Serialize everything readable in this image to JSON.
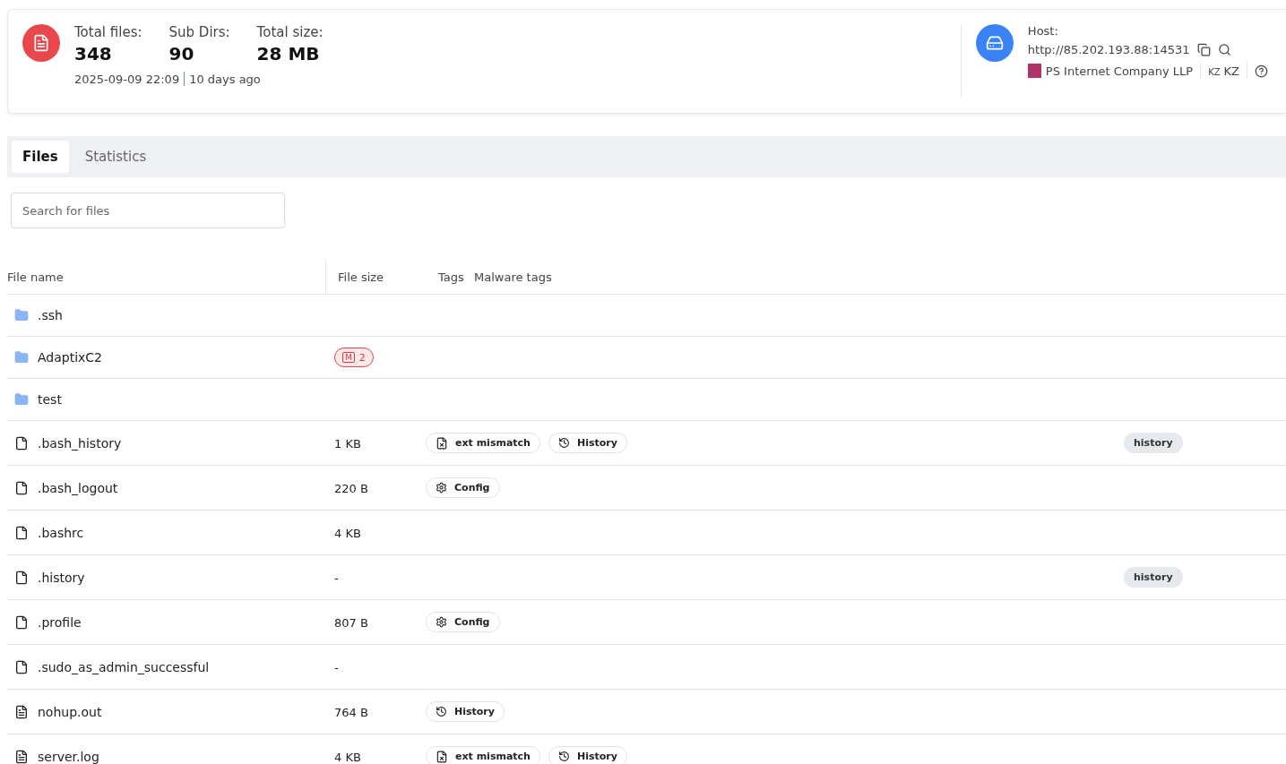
{
  "summary": {
    "stats": [
      {
        "label": "Total files:",
        "value": "348"
      },
      {
        "label": "Sub Dirs:",
        "value": "90"
      },
      {
        "label": "Total size:",
        "value": "28 MB"
      }
    ],
    "date": "2025-09-09 22:09",
    "ago": "10 days ago"
  },
  "host": {
    "label": "Host:",
    "url": "http://85.202.193.88:14531",
    "org": "PS Internet Company LLP",
    "country_code": "KZ",
    "country": "KZ"
  },
  "tabs": [
    {
      "label": "Files",
      "selected": true
    },
    {
      "label": "Statistics",
      "selected": false
    }
  ],
  "search": {
    "placeholder": "Search for files"
  },
  "table": {
    "columns": [
      "File name",
      "File size",
      "Tags",
      "Malware tags"
    ],
    "rows": [
      {
        "kind": "folder",
        "name": ".ssh"
      },
      {
        "kind": "folder",
        "name": "AdaptixC2",
        "badge": {
          "mark": "M",
          "count": "2"
        }
      },
      {
        "kind": "folder",
        "name": "test"
      },
      {
        "kind": "file",
        "name": ".bash_history",
        "size": "1 KB",
        "tags": [
          {
            "kind": "ext",
            "label": "ext mismatch"
          },
          {
            "kind": "history",
            "label": "History"
          }
        ],
        "extra": "history"
      },
      {
        "kind": "file",
        "name": ".bash_logout",
        "size": "220 B",
        "tags": [
          {
            "kind": "config",
            "label": "Config"
          }
        ]
      },
      {
        "kind": "file",
        "name": ".bashrc",
        "size": "4 KB"
      },
      {
        "kind": "file",
        "name": ".history",
        "size": "-",
        "extra": "history"
      },
      {
        "kind": "file",
        "name": ".profile",
        "size": "807 B",
        "tags": [
          {
            "kind": "config",
            "label": "Config"
          }
        ]
      },
      {
        "kind": "file",
        "name": ".sudo_as_admin_successful",
        "size": "-"
      },
      {
        "kind": "log",
        "name": "nohup.out",
        "size": "764 B",
        "tags": [
          {
            "kind": "history",
            "label": "History"
          }
        ]
      },
      {
        "kind": "log",
        "name": "server.log",
        "size": "4 KB",
        "tags": [
          {
            "kind": "ext",
            "label": "ext mismatch"
          },
          {
            "kind": "history",
            "label": "History"
          }
        ]
      }
    ]
  }
}
